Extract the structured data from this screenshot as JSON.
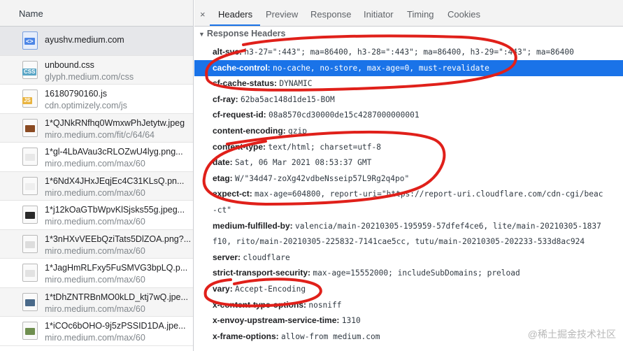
{
  "list": {
    "header": "Name",
    "items": [
      {
        "name": "ayushv.medium.com",
        "path": "",
        "type": "html",
        "tag": "<>",
        "thumb": ""
      },
      {
        "name": "unbound.css",
        "path": "glyph.medium.com/css",
        "type": "css",
        "tag": "CSS",
        "thumb": ""
      },
      {
        "name": "16180790160.js",
        "path": "cdn.optimizely.com/js",
        "type": "js",
        "tag": "JS",
        "thumb": ""
      },
      {
        "name": "1*QJNkRNfhq0WmxwPhJetytw.jpeg",
        "path": "miro.medium.com/fit/c/64/64",
        "type": "img",
        "tag": "",
        "thumb": "#8a4a22"
      },
      {
        "name": "1*gl-4LbAVau3cRLOZwU4lyg.png...",
        "path": "miro.medium.com/max/60",
        "type": "img",
        "tag": "",
        "thumb": "#e8e8e8"
      },
      {
        "name": "1*6NdX4JHxJEqjEc4C31KLsQ.pn...",
        "path": "miro.medium.com/max/60",
        "type": "img",
        "tag": "",
        "thumb": "#eeeeee"
      },
      {
        "name": "1*j12kOaGTbWpvKlSjsks55g.jpeg...",
        "path": "miro.medium.com/max/60",
        "type": "img",
        "tag": "",
        "thumb": "#2a2a2a"
      },
      {
        "name": "1*3nHXvVEEbQziTats5DlZOA.png?...",
        "path": "miro.medium.com/max/60",
        "type": "img",
        "tag": "",
        "thumb": "#dddddd"
      },
      {
        "name": "1*JagHmRLFxy5FuSMVG3bpLQ.p...",
        "path": "miro.medium.com/max/60",
        "type": "img",
        "tag": "",
        "thumb": "#e2e2e2"
      },
      {
        "name": "1*tDhZNTRBnMO0kLD_ktj7wQ.jpe...",
        "path": "miro.medium.com/max/60",
        "type": "img",
        "tag": "",
        "thumb": "#4a6a8a"
      },
      {
        "name": "1*iCOc6bOHO-9j5zPSSID1DA.jpe...",
        "path": "miro.medium.com/max/60",
        "type": "img",
        "tag": "",
        "thumb": "#6f8f4f"
      }
    ]
  },
  "tabs": {
    "close": "×",
    "items": [
      "Headers",
      "Preview",
      "Response",
      "Initiator",
      "Timing",
      "Cookies"
    ]
  },
  "section": {
    "title": "Response Headers",
    "arrow": "▼"
  },
  "headers": [
    {
      "name": "alt-svc:",
      "value": "h3-27=\":443\"; ma=86400, h3-28=\":443\"; ma=86400, h3-29=\":443\"; ma=86400",
      "highlight": false
    },
    {
      "name": "cache-control:",
      "value": "no-cache, no-store, max-age=0, must-revalidate",
      "highlight": true
    },
    {
      "name": "cf-cache-status:",
      "value": "DYNAMIC",
      "highlight": false
    },
    {
      "name": "cf-ray:",
      "value": "62ba5ac148d1de15-BOM",
      "highlight": false
    },
    {
      "name": "cf-request-id:",
      "value": "08a8570cd30000de15c4287000000001",
      "highlight": false
    },
    {
      "name": "content-encoding:",
      "value": "gzip",
      "highlight": false
    },
    {
      "name": "content-type:",
      "value": "text/html; charset=utf-8",
      "highlight": false
    },
    {
      "name": "date:",
      "value": "Sat, 06 Mar 2021 08:53:37 GMT",
      "highlight": false
    },
    {
      "name": "etag:",
      "value": "W/\"34d47-zoXg42vdbeNsseip57L9Rg2q4po\"",
      "highlight": false
    },
    {
      "name": "expect-ct:",
      "value": "max-age=604800, report-uri=\"https://report-uri.cloudflare.com/cdn-cgi/beac",
      "highlight": false
    },
    {
      "name": "",
      "value": "-ct\"",
      "highlight": false,
      "continuation": true
    },
    {
      "name": "medium-fulfilled-by:",
      "value": "valencia/main-20210305-195959-57dfef4ce6, lite/main-20210305-1837",
      "highlight": false
    },
    {
      "name": "",
      "value": "f10, rito/main-20210305-225832-7141cae5cc, tutu/main-20210305-202233-533d8ac924",
      "highlight": false,
      "continuation": true
    },
    {
      "name": "server:",
      "value": "cloudflare",
      "highlight": false
    },
    {
      "name": "strict-transport-security:",
      "value": "max-age=15552000; includeSubDomains; preload",
      "highlight": false
    },
    {
      "name": "vary:",
      "value": "Accept-Encoding",
      "highlight": false
    },
    {
      "name": "x-content-type-options:",
      "value": "nosniff",
      "highlight": false
    },
    {
      "name": "x-envoy-upstream-service-time:",
      "value": "1310",
      "highlight": false
    },
    {
      "name": "x-frame-options:",
      "value": "allow-from medium.com",
      "highlight": false
    }
  ],
  "colors": {
    "accent": "#1a73e8",
    "annotation": "#e0201a"
  },
  "watermark": "@稀土掘金技术社区"
}
